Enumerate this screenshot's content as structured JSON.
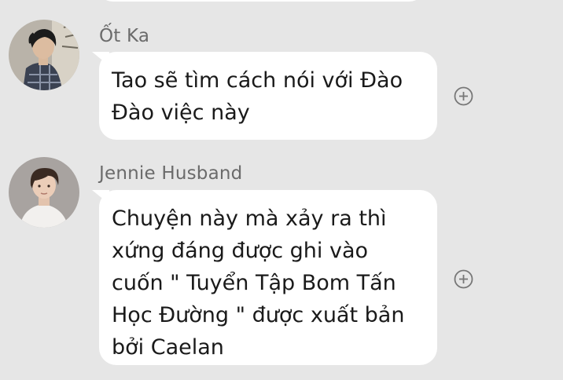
{
  "messages": [
    {
      "sender": "Ốt Ka",
      "text": "Tao sẽ tìm cách nói với Đào\nĐào việc này",
      "avatar_icon": "profile-photo-boy-dark-hair-icon"
    },
    {
      "sender": "Jennie Husband",
      "text": "Chuyện này mà xảy ra thì\nxứng đáng được ghi vào\ncuốn \" Tuyển Tập Bom Tấn\nHọc Đường \" được xuất bản\nbởi Caelan",
      "avatar_icon": "profile-photo-boy-white-shirt-icon"
    }
  ],
  "icons": {
    "react_button": "add-circle-icon"
  },
  "colors": {
    "background": "#e6e6e6",
    "bubble": "#ffffff",
    "sender_name": "#6b6b6b",
    "message_text": "#1a1a1a"
  }
}
